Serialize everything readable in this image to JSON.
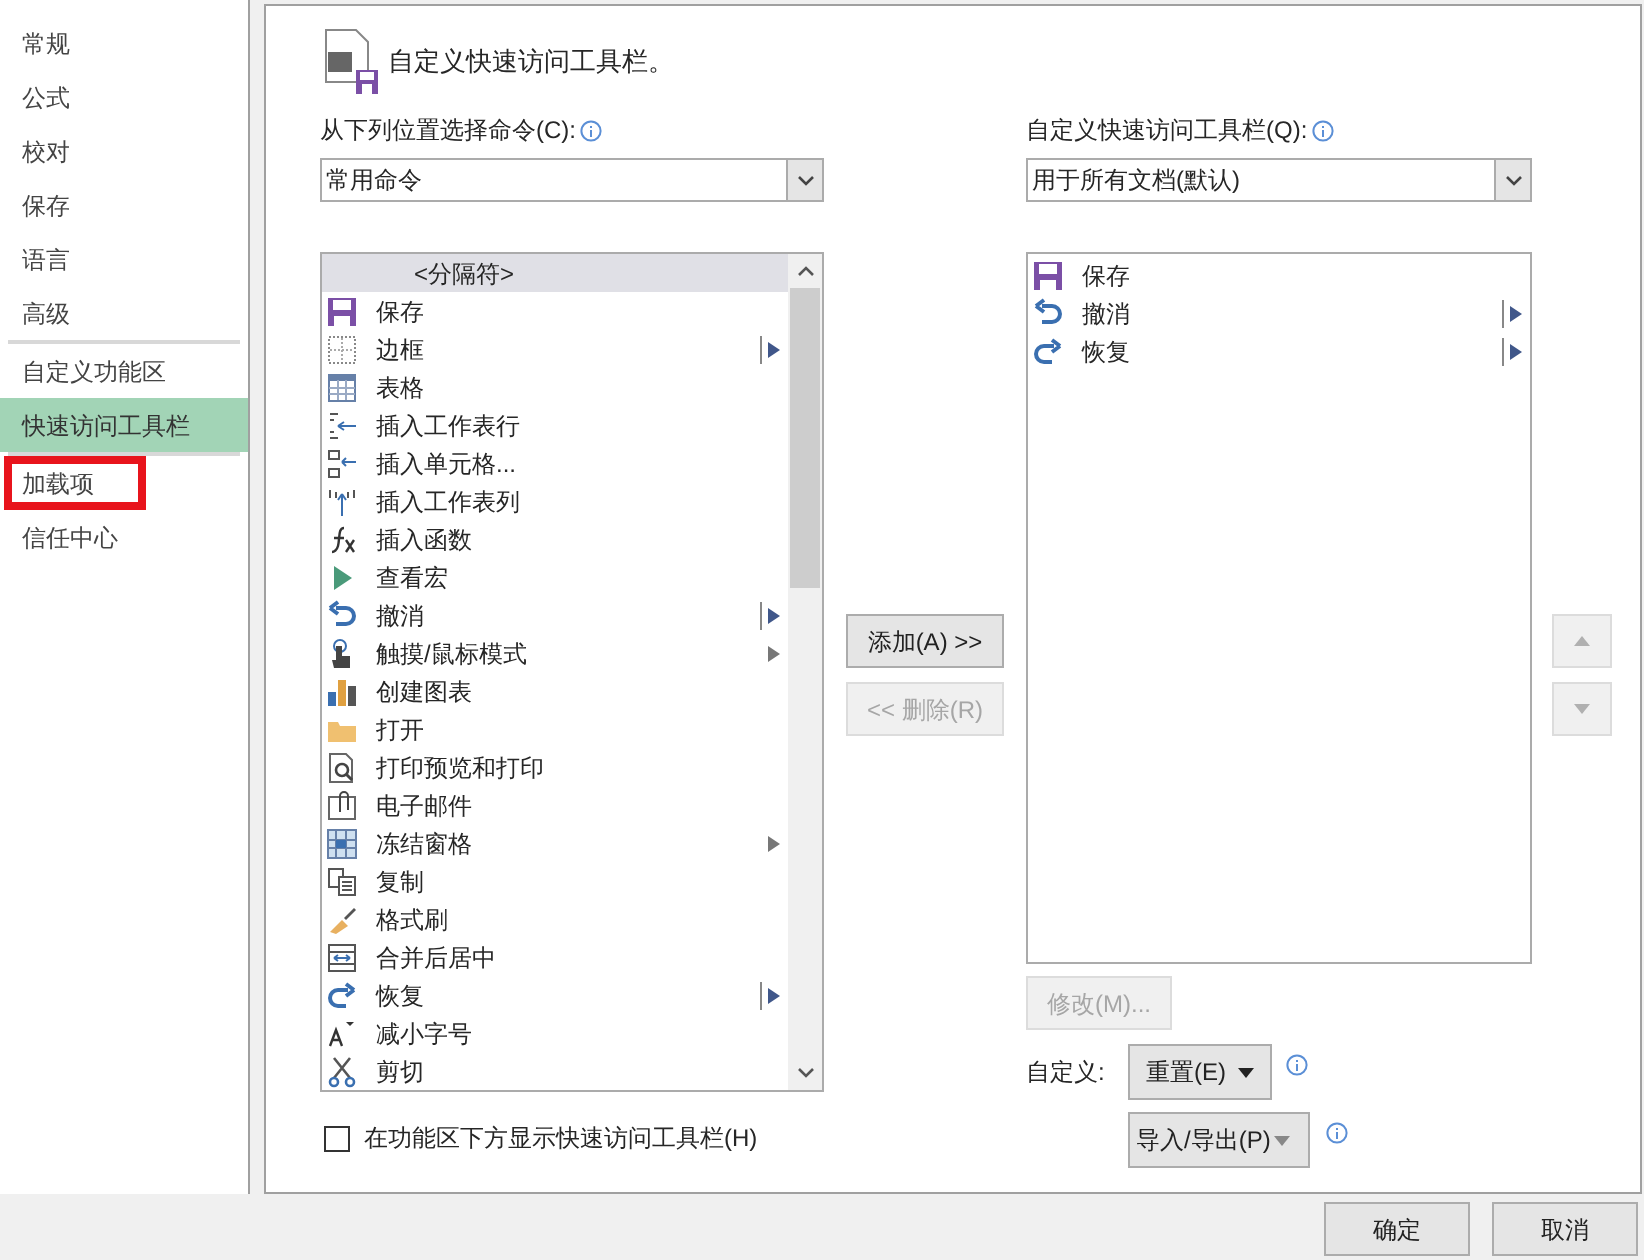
{
  "sidebar": {
    "groups": [
      [
        {
          "label": "常规",
          "selected": false,
          "highlighted": false
        },
        {
          "label": "公式",
          "selected": false,
          "highlighted": false
        },
        {
          "label": "校对",
          "selected": false,
          "highlighted": false
        },
        {
          "label": "保存",
          "selected": false,
          "highlighted": false
        },
        {
          "label": "语言",
          "selected": false,
          "highlighted": false
        },
        {
          "label": "高级",
          "selected": false,
          "highlighted": false
        }
      ],
      [
        {
          "label": "自定义功能区",
          "selected": false,
          "highlighted": false
        },
        {
          "label": "快速访问工具栏",
          "selected": true,
          "highlighted": false
        }
      ],
      [
        {
          "label": "加载项",
          "selected": false,
          "highlighted": true
        },
        {
          "label": "信任中心",
          "selected": false,
          "highlighted": false
        }
      ]
    ]
  },
  "header": {
    "title": "自定义快速访问工具栏。"
  },
  "commands": {
    "label": "从下列位置选择命令(C):",
    "dropdown": {
      "value": "常用命令"
    },
    "items": [
      {
        "label": "<分隔符>",
        "kind": "separator",
        "selected": true
      },
      {
        "label": "保存",
        "kind": "save",
        "selected": false
      },
      {
        "label": "边框",
        "kind": "border",
        "submenu": {
          "kind": "split"
        },
        "selected": false
      },
      {
        "label": "表格",
        "kind": "table",
        "selected": false
      },
      {
        "label": "插入工作表行",
        "kind": "insert-row",
        "selected": false
      },
      {
        "label": "插入单元格...",
        "kind": "insert-cells",
        "selected": false
      },
      {
        "label": "插入工作表列",
        "kind": "insert-column",
        "selected": false
      },
      {
        "label": "插入函数",
        "kind": "function",
        "selected": false
      },
      {
        "label": "查看宏",
        "kind": "play",
        "selected": false
      },
      {
        "label": "撤消",
        "kind": "undo",
        "submenu": {
          "kind": "split"
        },
        "selected": false
      },
      {
        "label": "触摸/鼠标模式",
        "kind": "hand",
        "submenu": {
          "kind": "plain"
        },
        "selected": false
      },
      {
        "label": "创建图表",
        "kind": "chart",
        "selected": false
      },
      {
        "label": "打开",
        "kind": "folder",
        "selected": false
      },
      {
        "label": "打印预览和打印",
        "kind": "preview",
        "selected": false
      },
      {
        "label": "电子邮件",
        "kind": "mail",
        "selected": false
      },
      {
        "label": "冻结窗格",
        "kind": "freeze",
        "submenu": {
          "kind": "plain"
        },
        "selected": false
      },
      {
        "label": "复制",
        "kind": "copy",
        "selected": false
      },
      {
        "label": "格式刷",
        "kind": "brush",
        "selected": false
      },
      {
        "label": "合并后居中",
        "kind": "merge",
        "selected": false
      },
      {
        "label": "恢复",
        "kind": "redo",
        "submenu": {
          "kind": "split"
        },
        "selected": false
      },
      {
        "label": "减小字号",
        "kind": "font-size",
        "selected": false
      },
      {
        "label": "剪切",
        "kind": "scissors",
        "selected": false
      }
    ],
    "checkbox": {
      "label": "在功能区下方显示快速访问工具栏(H)",
      "checked": false
    }
  },
  "transfer": {
    "add": {
      "label": "添加(A) >>",
      "disabled": false
    },
    "remove": {
      "label": "<< 删除(R)",
      "disabled": true
    }
  },
  "toolbar": {
    "label": "自定义快速访问工具栏(Q):",
    "dropdown": {
      "value": "用于所有文档(默认)"
    },
    "items": [
      {
        "label": "保存",
        "kind": "save",
        "selected": false
      },
      {
        "label": "撤消",
        "kind": "undo",
        "submenu": {
          "kind": "split"
        },
        "selected": false
      },
      {
        "label": "恢复",
        "kind": "redo",
        "submenu": {
          "kind": "split"
        },
        "selected": false
      }
    ],
    "modify": {
      "label": "修改(M)...",
      "disabled": true
    },
    "customize_label": "自定义:",
    "reset": {
      "label": "重置(E)"
    },
    "import_export": {
      "label": "导入/导出(P)"
    },
    "move_up": {
      "disabled": true
    },
    "move_down": {
      "disabled": true
    }
  },
  "footer": {
    "buttons": [
      "确定",
      "取消"
    ]
  }
}
